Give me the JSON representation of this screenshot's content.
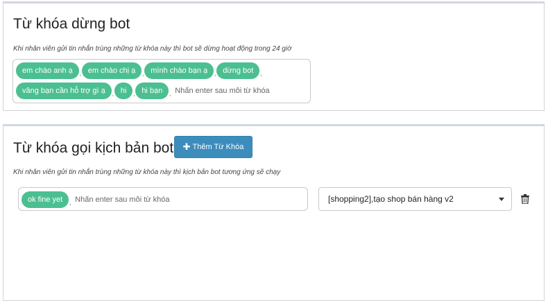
{
  "stop_panel": {
    "title": "Từ khóa dừng bot",
    "hint": "Khi nhân viên gửi tin nhắn trùng những từ khóa này thì bot sẽ dừng hoạt động trong 24 giờ",
    "tags": [
      "em chào anh ạ",
      "em chào chị ạ",
      "mình chào bạn ạ",
      "dừng bot",
      "vâng bạn cần hỗ trợ gì ạ",
      "hi",
      "hi bạn"
    ],
    "input_placeholder": "Nhấn enter sau mỗi từ khóa"
  },
  "trigger_panel": {
    "title": "Từ khóa gọi kịch bản bot",
    "add_button_label": "Thêm Từ Khóa",
    "add_button_icon": "plus-icon",
    "hint": "Khi nhân viên gửi tin nhắn trùng những từ khóa này thì kịch bản bot tương ứng sẽ chạy",
    "rows": [
      {
        "tags": [
          "ok fine yet"
        ],
        "input_placeholder": "Nhấn enter sau mỗi từ khóa",
        "scenario_selected": "[shopping2],tạo shop bán hàng v2",
        "delete_icon": "trash-icon"
      }
    ]
  },
  "colors": {
    "tag": "#4cbf91",
    "primary_button": "#3c8dbc",
    "panel_border_top": "#d2d6de"
  }
}
